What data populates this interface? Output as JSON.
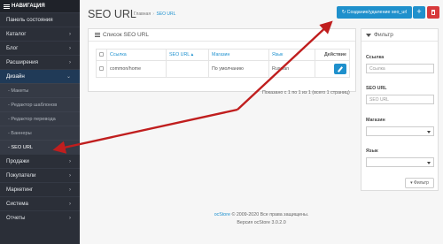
{
  "sidebar": {
    "header": "НАВИГАЦИЯ",
    "items": [
      {
        "label": "Панель состояния"
      },
      {
        "label": "Каталог"
      },
      {
        "label": "Блог"
      },
      {
        "label": "Расширения"
      },
      {
        "label": "Дизайн"
      },
      {
        "label": "Макеты"
      },
      {
        "label": "Редактор шаблонов"
      },
      {
        "label": "Редактор перевода"
      },
      {
        "label": "Баннеры"
      },
      {
        "label": "SEO URL"
      },
      {
        "label": "Продажи"
      },
      {
        "label": "Покупатели"
      },
      {
        "label": "Маркетинг"
      },
      {
        "label": "Система"
      },
      {
        "label": "Отчеты"
      }
    ]
  },
  "header": {
    "title": "SEO URL",
    "breadcrumb": [
      "Главная",
      "SEO URL"
    ],
    "create_button": "Создание/удаление seo_url",
    "add_button": "+"
  },
  "list": {
    "title": "Список SEO URL",
    "columns": [
      "Ссылка",
      "SEO URL",
      "Магазин",
      "Язык",
      "Действие"
    ],
    "rows": [
      {
        "link": "common/home",
        "seo_url": "",
        "store": "По умолчанию",
        "language": "Russian"
      }
    ],
    "pagination": "Показано с 1 по 1 из 1 (всего 1 страниц)"
  },
  "filter": {
    "title": "Фильтр",
    "link_label": "Ссылка",
    "link_placeholder": "Ссылка",
    "seo_label": "SEO URL",
    "seo_placeholder": "SEO URL",
    "store_label": "Магазин",
    "lang_label": "Язык",
    "button": "Фильтр"
  },
  "footer": {
    "brand": "ocStore",
    "copyright": " © 2009-2020 Все права защищены.",
    "version": "Версия ocStore 3.0.2.0"
  },
  "colors": {
    "accent": "#1f90cc",
    "danger": "#d7393b",
    "sidebar": "#2b2f38",
    "arrow": "#c01e1e"
  }
}
